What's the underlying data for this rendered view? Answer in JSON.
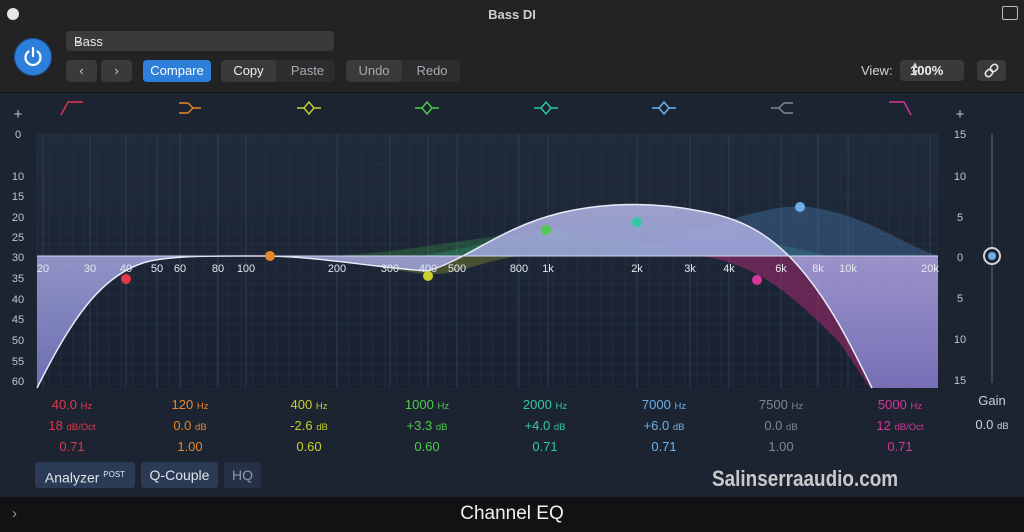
{
  "window": {
    "title": "Bass DI"
  },
  "header": {
    "preset": "Bass",
    "compare": "Compare",
    "copy": "Copy",
    "paste": "Paste",
    "undo": "Undo",
    "redo": "Redo",
    "view_label": "View:",
    "view_value": "100%"
  },
  "graph": {
    "db_scale_left": [
      "+",
      "0",
      "10",
      "15",
      "20",
      "25",
      "30",
      "35",
      "40",
      "45",
      "50",
      "55",
      "60"
    ],
    "db_scale_right": [
      "+",
      "15",
      "10",
      "5",
      "0",
      "5",
      "10",
      "15"
    ],
    "freq_labels": [
      "20",
      "30",
      "40",
      "50",
      "60",
      "80",
      "100",
      "200",
      "300",
      "400",
      "500",
      "800",
      "1k",
      "2k",
      "3k",
      "4k",
      "6k",
      "8k",
      "10k",
      "20k"
    ]
  },
  "bands": [
    {
      "type": "low-cut",
      "freq": "40.0",
      "freq_unit": "Hz",
      "gain": "18",
      "gain_unit": "dB/Oct",
      "q": "0.71",
      "color": "#e2374a"
    },
    {
      "type": "low-shelf",
      "freq": "120",
      "freq_unit": "Hz",
      "gain": "0.0",
      "gain_unit": "dB",
      "q": "1.00",
      "color": "#e8872a"
    },
    {
      "type": "bell",
      "freq": "400",
      "freq_unit": "Hz",
      "gain": "-2.6",
      "gain_unit": "dB",
      "q": "0.60",
      "color": "#c9cf2d"
    },
    {
      "type": "bell",
      "freq": "1000",
      "freq_unit": "Hz",
      "gain": "+3.3",
      "gain_unit": "dB",
      "q": "0.60",
      "color": "#4fcb4f"
    },
    {
      "type": "bell",
      "freq": "2000",
      "freq_unit": "Hz",
      "gain": "+4.0",
      "gain_unit": "dB",
      "q": "0.71",
      "color": "#2fc9a2"
    },
    {
      "type": "bell",
      "freq": "7000",
      "freq_unit": "Hz",
      "gain": "+6.0",
      "gain_unit": "dB",
      "q": "0.71",
      "color": "#6fb0ea"
    },
    {
      "type": "high-shelf",
      "freq": "7500",
      "freq_unit": "Hz",
      "gain": "0.0",
      "gain_unit": "dB",
      "q": "1.00",
      "color": "#7d8797"
    },
    {
      "type": "high-cut",
      "freq": "5000",
      "freq_unit": "Hz",
      "gain": "12",
      "gain_unit": "dB/Oct",
      "q": "0.71",
      "color": "#d8369a"
    }
  ],
  "gain": {
    "label": "Gain",
    "value": "0.0",
    "unit": "dB"
  },
  "bottom": {
    "analyzer": "Analyzer",
    "analyzer_sup": "POST",
    "q_couple": "Q-Couple",
    "hq": "HQ",
    "watermark": "Salinserraaudio.com"
  },
  "footer": {
    "plugin_name": "Channel EQ"
  }
}
